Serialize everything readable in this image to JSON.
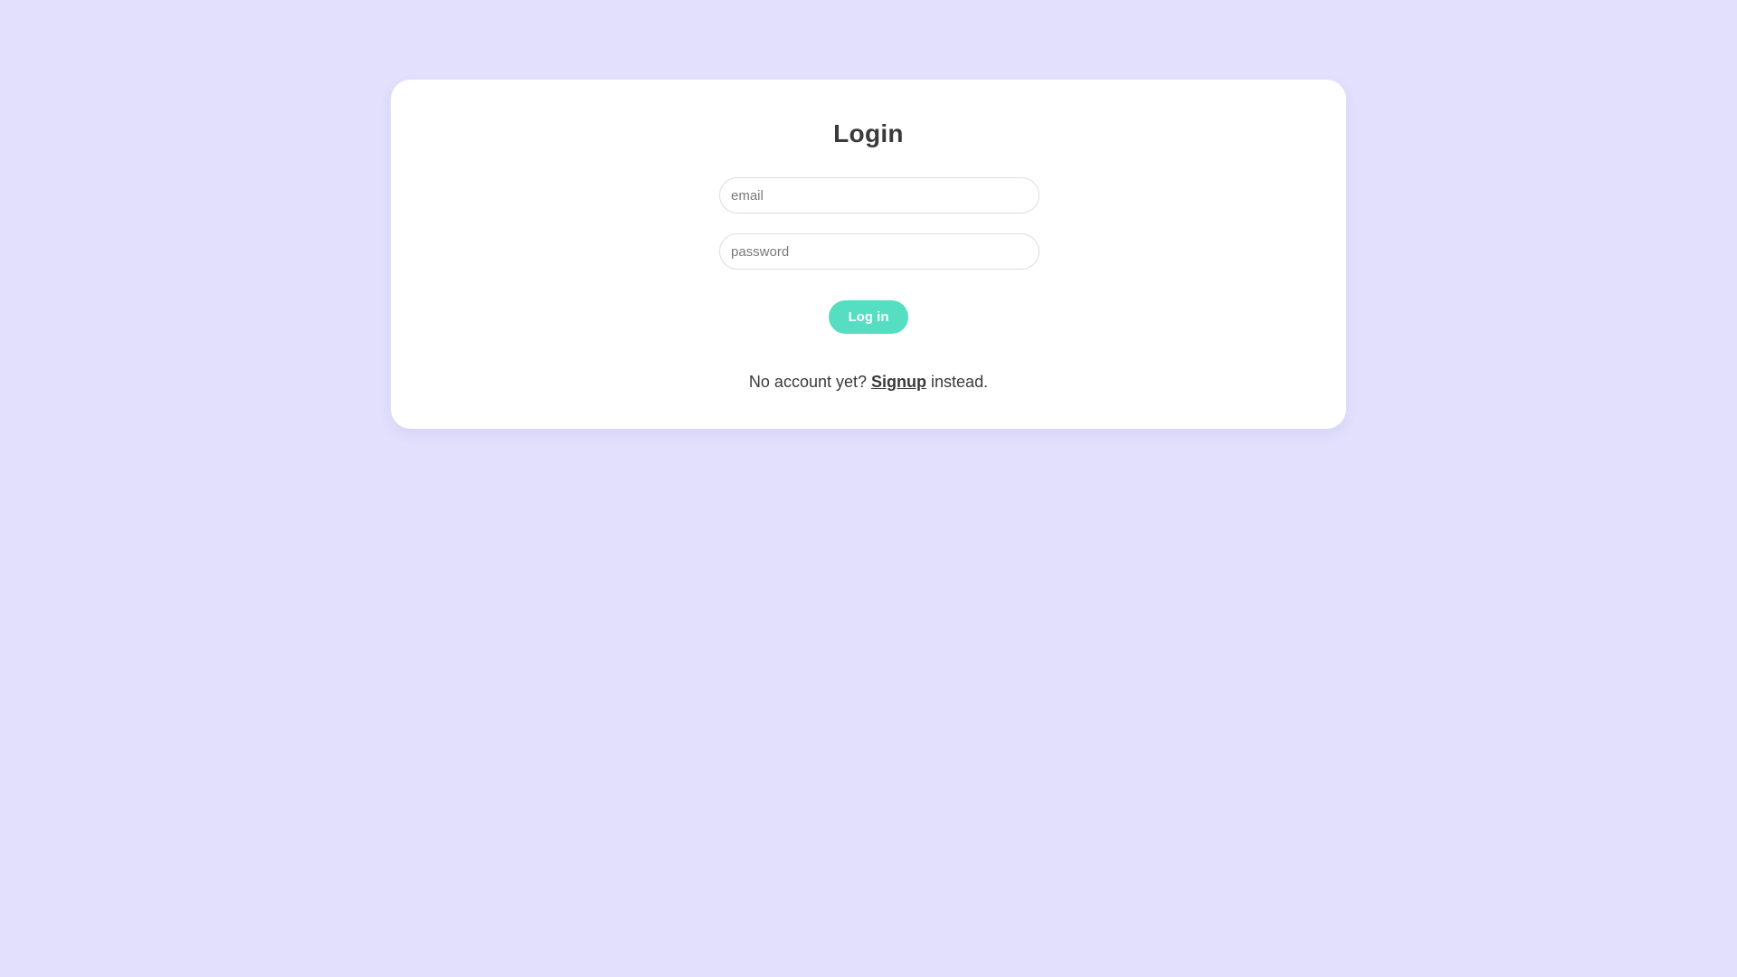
{
  "login": {
    "title": "Login",
    "email_placeholder": "email",
    "password_placeholder": "password",
    "submit_label": "Log in",
    "footer_prefix": "No account yet?",
    "signup_link": "Signup",
    "footer_suffix": "instead."
  },
  "colors": {
    "background": "#e2e0fd",
    "card": "#ffffff",
    "accent": "#56dec2",
    "text": "#3a3a3a"
  }
}
